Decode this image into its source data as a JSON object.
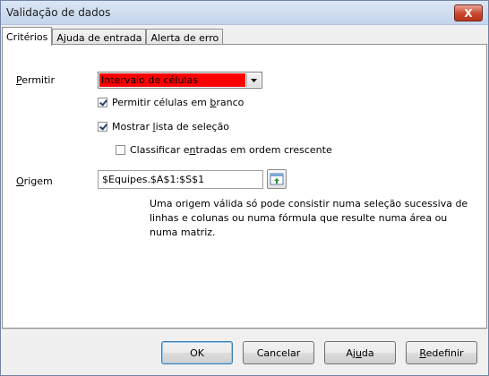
{
  "window": {
    "title": "Validação de dados",
    "close_label": "X"
  },
  "tabs": [
    {
      "label": "Critérios",
      "active": true
    },
    {
      "label": "Ajuda de entrada",
      "active": false
    },
    {
      "label": "Alerta de erro",
      "active": false
    }
  ],
  "criteria": {
    "allow": {
      "label_pre": "",
      "label_u": "P",
      "label_post": "ermitir",
      "value": "Intervalo de células"
    },
    "allow_blank": {
      "pre": "Permitir células em ",
      "u": "b",
      "post": "ranco",
      "checked": true
    },
    "show_list": {
      "pre": "Mostrar ",
      "u": "l",
      "post": "ista de seleção",
      "checked": true
    },
    "sort_entries": {
      "pre": "Classificar e",
      "u": "n",
      "post": "tradas em ordem crescente",
      "checked": false
    },
    "source": {
      "label_u": "O",
      "label_post": "rigem",
      "value": "$Equipes.$A$1:$S$1"
    },
    "help_text": "Uma origem válida só pode consistir numa seleção sucessiva de linhas e colunas ou numa fórmula que resulte numa área ou numa matriz."
  },
  "buttons": {
    "ok": "OK",
    "cancel": "Cancelar",
    "help_pre": "Aj",
    "help_u": "u",
    "help_post": "da",
    "reset_u": "R",
    "reset_post": "edefinir"
  }
}
